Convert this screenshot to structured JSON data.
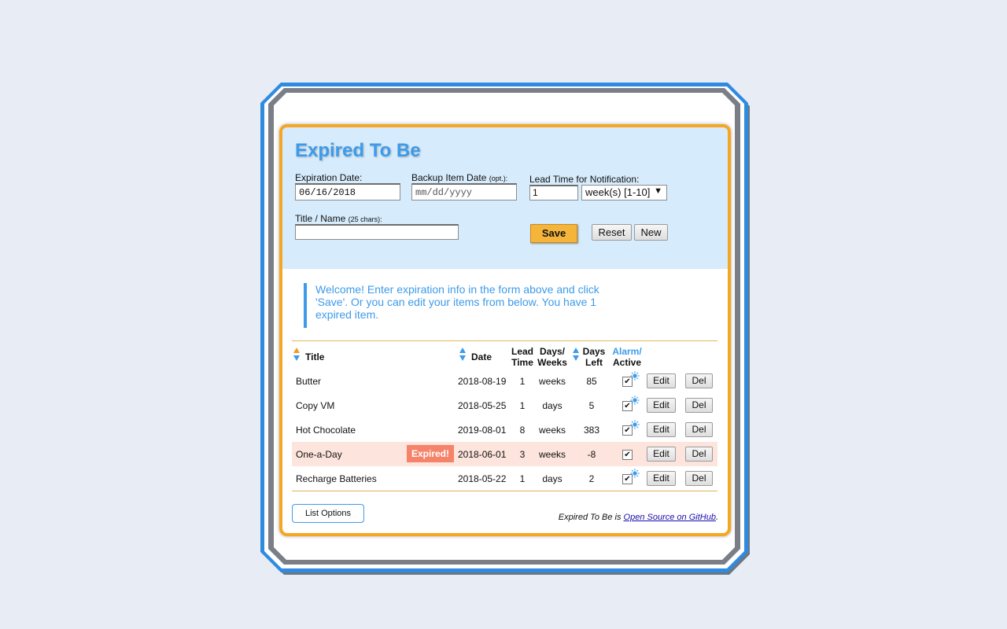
{
  "app": {
    "title": "Expired To Be"
  },
  "form": {
    "expiration_label": "Expiration Date:",
    "expiration_value": "06/16/2018",
    "backup_label": "Backup Item Date",
    "backup_label_opt": "(opt.):",
    "backup_placeholder": "mm/dd/yyyy",
    "lead_label": "Lead Time for Notification:",
    "lead_value": "1",
    "lead_unit_selected": "week(s) [1-10]",
    "title_label": "Title / Name",
    "title_label_hint": "(25 chars):",
    "title_value": "",
    "save_label": "Save",
    "reset_label": "Reset",
    "new_label": "New"
  },
  "welcome_message": "Welcome! Enter expiration info in the form above and click 'Save'. Or you can edit your items from below. You have 1 expired item.",
  "table": {
    "headers": {
      "title": "Title",
      "date": "Date",
      "lead_time_1": "Lead",
      "lead_time_2": "Time",
      "days_weeks_1": "Days/",
      "days_weeks_2": "Weeks",
      "days_left_1": "Days",
      "days_left_2": "Left",
      "alarm": "Alarm/",
      "active": "Active"
    },
    "edit_label": "Edit",
    "del_label": "Del",
    "expired_badge": "Expired!",
    "rows": [
      {
        "title": "Butter",
        "date": "2018-08-19",
        "lead": "1",
        "unit": "weeks",
        "days_left": "85",
        "active": true,
        "alarm": true,
        "expired": false
      },
      {
        "title": "Copy VM",
        "date": "2018-05-25",
        "lead": "1",
        "unit": "days",
        "days_left": "5",
        "active": true,
        "alarm": true,
        "expired": false
      },
      {
        "title": "Hot Chocolate",
        "date": "2019-08-01",
        "lead": "8",
        "unit": "weeks",
        "days_left": "383",
        "active": true,
        "alarm": true,
        "expired": false
      },
      {
        "title": "One-a-Day",
        "date": "2018-06-01",
        "lead": "3",
        "unit": "weeks",
        "days_left": "-8",
        "active": true,
        "alarm": false,
        "expired": true
      },
      {
        "title": "Recharge Batteries",
        "date": "2018-05-22",
        "lead": "1",
        "unit": "days",
        "days_left": "2",
        "active": true,
        "alarm": true,
        "expired": false
      }
    ]
  },
  "footer": {
    "list_options_label": "List Options",
    "prefix": "Expired To Be",
    "middle": " is ",
    "link_text": "Open Source on GitHub",
    "suffix": "."
  },
  "colors": {
    "accent_blue": "#3d9be9",
    "accent_orange": "#f5a623",
    "form_bg": "#d6ebfb",
    "expired_row": "#fde4dc",
    "expired_badge": "#f4836a",
    "page_bg": "#e8ecf4"
  }
}
